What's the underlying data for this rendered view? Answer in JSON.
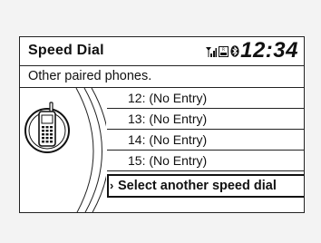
{
  "header": {
    "title": "Speed Dial",
    "clock": "12:34"
  },
  "status": {
    "signal_icon": "signal-strength-icon",
    "roam_icon": "roaming-icon",
    "bluetooth_icon": "bluetooth-icon"
  },
  "subheader": {
    "text": "Other paired phones."
  },
  "list": {
    "items": [
      {
        "label": "12: (No Entry)"
      },
      {
        "label": "13: (No Entry)"
      },
      {
        "label": "14: (No Entry)"
      },
      {
        "label": "15: (No Entry)"
      }
    ],
    "selected_label": "Select another speed dial"
  },
  "phone_icon": "mobile-phone-icon"
}
